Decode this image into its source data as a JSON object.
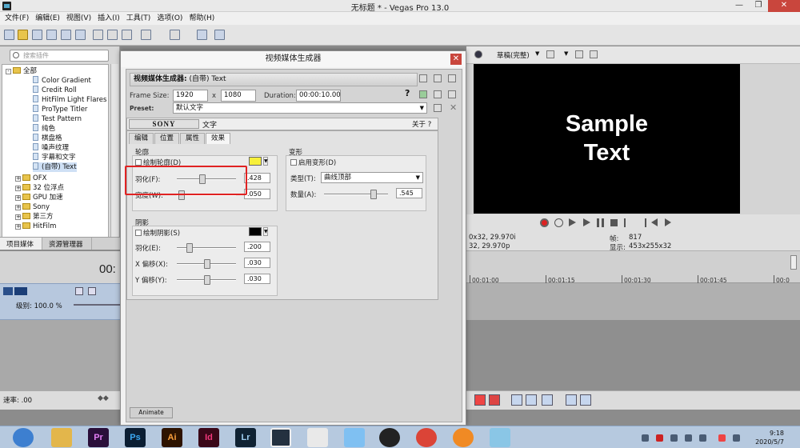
{
  "window": {
    "title": "无标题 * - Vegas Pro 13.0"
  },
  "menu": [
    "文件(F)",
    "编辑(E)",
    "视图(V)",
    "插入(I)",
    "工具(T)",
    "选项(O)",
    "帮助(H)"
  ],
  "left_panel": {
    "search_placeholder": "搜索插件",
    "tree": [
      {
        "label": "全部",
        "kind": "folder",
        "expanded": true
      },
      {
        "label": "Color Gradient",
        "kind": "file"
      },
      {
        "label": "Credit Roll",
        "kind": "file"
      },
      {
        "label": "HitFilm Light Flares",
        "kind": "file"
      },
      {
        "label": "ProType Titler",
        "kind": "file"
      },
      {
        "label": "Test Pattern",
        "kind": "file"
      },
      {
        "label": "纯色",
        "kind": "file"
      },
      {
        "label": "棋盘格",
        "kind": "file"
      },
      {
        "label": "噪声纹理",
        "kind": "file"
      },
      {
        "label": "字幕和文字",
        "kind": "file"
      },
      {
        "label": "(自带) Text",
        "kind": "file",
        "selected": true
      },
      {
        "label": "OFX",
        "kind": "folder"
      },
      {
        "label": "32 位浮点",
        "kind": "folder"
      },
      {
        "label": "GPU 加速",
        "kind": "folder"
      },
      {
        "label": "Sony",
        "kind": "folder"
      },
      {
        "label": "第三方",
        "kind": "folder"
      },
      {
        "label": "HitFilm",
        "kind": "folder"
      }
    ],
    "tabs": [
      "项目媒体",
      "资源管理器"
    ]
  },
  "timeline": {
    "time": "00:",
    "level": "级别: 100.0 %",
    "rate": "速率: .00",
    "ruler_labels": [
      "00:01:00",
      "00:01:15",
      "00:01:30",
      "00:01:45",
      "00:0"
    ]
  },
  "preview": {
    "quality": "草稿(完整)",
    "sample_text": [
      "Sample",
      "Text"
    ],
    "info_left_1": "0x32, 29.970i",
    "info_left_2": "32, 29.970p",
    "frame_label": "帧:",
    "frame_value": "817",
    "display_label": "显示:",
    "display_value": "453x255x32"
  },
  "dialog": {
    "title": "视频媒体生成器",
    "header_label": "视频媒体生成器:",
    "header_value": "(自带) Text",
    "frame_size_label": "Frame Size:",
    "frame_w": "1920",
    "frame_x": "x",
    "frame_h": "1080",
    "duration_label": "Duration:",
    "duration": "00:00:10.00",
    "preset_label": "Preset:",
    "preset_value": "默认文字",
    "sony": "SONY",
    "plugin_name": "文字",
    "about": "关于",
    "about_q": "?",
    "tabs": [
      "编辑",
      "位置",
      "属性",
      "效果"
    ],
    "active_tab": "效果",
    "outline": {
      "title": "轮廓",
      "enable_label": "绘制轮廓(D)",
      "color": "#f7f03a",
      "feather_label": "羽化(F):",
      "feather_value": ".428",
      "feather_fraction": 0.43,
      "width_label": "宽度(W):",
      "width_value": ".050",
      "width_fraction": 0.05
    },
    "deform": {
      "title": "变形",
      "enable_label": "启用变形(D)",
      "type_label": "类型(T):",
      "type_value": "曲线顶部",
      "amount_label": "数量(A):",
      "amount_value": ".545",
      "amount_fraction": 0.78
    },
    "shadow": {
      "title": "阴影",
      "enable_label": "绘制阴影(S)",
      "color": "#000000",
      "feather_label": "羽化(E):",
      "feather_value": ".200",
      "feather_fraction": 0.2,
      "xoff_label": "X 偏移(X):",
      "xoff_value": ".030",
      "xoff_fraction": 0.52,
      "yoff_label": "Y 偏移(Y):",
      "yoff_value": ".030",
      "yoff_fraction": 0.52
    },
    "animate": "Animate"
  },
  "taskbar": {
    "apps": [
      "Pr",
      "Ps",
      "Ai",
      "Id",
      "Lr"
    ],
    "time": "9:18",
    "date": "2020/5/7"
  },
  "colors": {
    "highlight_box": "#e02222",
    "preview_bg": "#000000"
  }
}
